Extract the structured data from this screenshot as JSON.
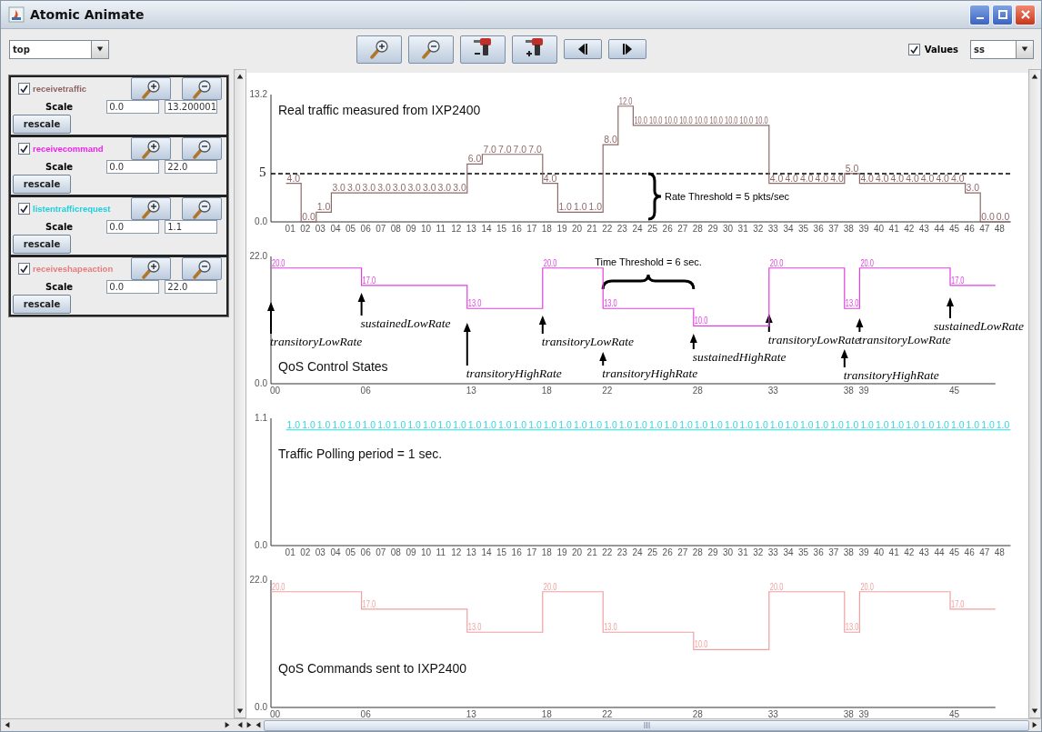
{
  "window": {
    "title": "Atomic Animate"
  },
  "toolbar": {
    "view_select": {
      "value": "top"
    },
    "tools": [
      {
        "kind": "zoom_in"
      },
      {
        "kind": "zoom_out"
      },
      {
        "kind": "drill_minus"
      },
      {
        "kind": "drill_plus"
      },
      {
        "kind": "step_back"
      },
      {
        "kind": "step_forward"
      }
    ],
    "values_toggle": {
      "label": "Values",
      "checked": true
    },
    "format_select": {
      "value": "ss"
    }
  },
  "signals": [
    {
      "name": "receivetraffic",
      "color": "#8e6464",
      "checked": true,
      "scale_label": "Scale",
      "min": "0.0",
      "max": "13.200001",
      "rescale": "rescale"
    },
    {
      "name": "receivecommand",
      "color": "#ee22ee",
      "checked": true,
      "scale_label": "Scale",
      "min": "0.0",
      "max": "22.0",
      "rescale": "rescale"
    },
    {
      "name": "listentrafficrequest",
      "color": "#1ccfdc",
      "checked": true,
      "scale_label": "Scale",
      "min": "0.0",
      "max": "1.1",
      "rescale": "rescale"
    },
    {
      "name": "receiveshapeaction",
      "color": "#e87c7c",
      "checked": true,
      "scale_label": "Scale",
      "min": "0.0",
      "max": "22.0",
      "rescale": "rescale"
    }
  ],
  "charts": [
    {
      "chart_data": {
        "type": "line",
        "title": "Real traffic measured from IXP2400",
        "x": [
          1,
          2,
          2,
          3,
          3,
          4,
          4,
          5,
          6,
          7,
          8,
          9,
          10,
          11,
          12,
          13,
          13,
          14,
          14,
          15,
          16,
          17,
          18,
          18,
          19,
          19,
          20,
          21,
          22,
          22,
          23,
          23,
          24,
          24,
          25,
          26,
          27,
          28,
          29,
          30,
          31,
          32,
          33,
          33,
          34,
          35,
          36,
          37,
          38,
          38,
          39,
          39,
          40,
          41,
          42,
          43,
          44,
          45,
          46,
          46,
          47,
          47,
          48,
          49
        ],
        "series": [
          {
            "color": "#8e6a6a",
            "values": [
              4,
              4,
              0,
              0,
              1,
              1,
              3,
              3,
              3,
              3,
              3,
              3,
              3,
              3,
              3,
              3,
              6,
              6,
              7,
              7,
              7,
              7,
              7,
              4,
              4,
              1,
              1,
              1,
              1,
              8,
              8,
              12,
              12,
              10,
              10,
              10,
              10,
              10,
              10,
              10,
              10,
              10,
              10,
              4,
              4,
              4,
              4,
              4,
              4,
              5,
              5,
              4,
              4,
              4,
              4,
              4,
              4,
              4,
              4,
              3,
              3,
              0,
              0,
              0
            ],
            "value_labels": [
              "4.0",
              null,
              "0.0",
              null,
              "1.0",
              null,
              "3.0",
              "3.0",
              "3.0",
              "3.0",
              "3.0",
              "3.0",
              "3.0",
              "3.0",
              "3.0",
              null,
              "6.0",
              null,
              "7.0",
              "7.0",
              "7.0",
              "7.0",
              null,
              "4.0",
              null,
              "1.0",
              "1.0",
              "1.0",
              null,
              "8.0",
              null,
              "12.0",
              null,
              "10.0",
              "10.0",
              "10.0",
              "10.0",
              "10.0",
              "10.0",
              "10.0",
              "10.0",
              "10.0",
              null,
              "4.0",
              "4.0",
              "4.0",
              "4.0",
              "4.0",
              null,
              "5.0",
              null,
              "4.0",
              "4.0",
              "4.0",
              "4.0",
              "4.0",
              "4.0",
              "4.0",
              null,
              "3.0",
              null,
              "0.0",
              "0.0",
              null
            ]
          }
        ],
        "xlim": [
          0,
          49
        ],
        "ylim": [
          0,
          13.2
        ],
        "xticks": [
          {
            "value": 1,
            "label": "01"
          },
          {
            "value": 2,
            "label": "02"
          },
          {
            "value": 3,
            "label": "03"
          },
          {
            "value": 4,
            "label": "04"
          },
          {
            "value": 5,
            "label": "05"
          },
          {
            "value": 6,
            "label": "06"
          },
          {
            "value": 7,
            "label": "07"
          },
          {
            "value": 8,
            "label": "08"
          },
          {
            "value": 9,
            "label": "09"
          },
          10,
          11,
          12,
          13,
          14,
          15,
          16,
          17,
          18,
          19,
          20,
          21,
          22,
          23,
          24,
          25,
          26,
          27,
          28,
          29,
          30,
          31,
          32,
          33,
          34,
          35,
          36,
          37,
          38,
          39,
          40,
          41,
          42,
          43,
          44,
          45,
          46,
          47,
          48
        ],
        "yticks": [
          {
            "value": 0,
            "label": "0.0"
          },
          {
            "value": 13.2,
            "label": "13.2"
          }
        ],
        "ref_lines": [
          {
            "axis": "y",
            "value": 5,
            "label": "5"
          }
        ],
        "annotations": [
          "Rate Threshold = 5 pkts/sec"
        ]
      }
    },
    {
      "chart_data": {
        "type": "line",
        "title": "QoS Control States",
        "x": [
          0,
          6,
          6,
          13,
          13,
          18,
          18,
          22,
          22,
          28,
          28,
          33,
          33,
          38,
          38,
          39,
          39,
          45,
          45,
          48
        ],
        "series": [
          {
            "color": "#e040e0",
            "values": [
              20,
              20,
              17,
              17,
              13,
              13,
              20,
              20,
              13,
              13,
              10,
              10,
              20,
              20,
              13,
              13,
              20,
              20,
              17,
              17
            ],
            "value_labels": [
              "20.0",
              null,
              "17.0",
              null,
              "13.0",
              null,
              "20.0",
              null,
              "13.0",
              null,
              "10.0",
              null,
              "20.0",
              null,
              "13.0",
              null,
              "20.0",
              null,
              "17.0",
              null
            ]
          }
        ],
        "xlim": [
          0,
          48
        ],
        "ylim": [
          0,
          22
        ],
        "xticks": [
          {
            "value": 0,
            "label": "00"
          },
          {
            "value": 6,
            "label": "06"
          },
          13,
          18,
          22,
          28,
          33,
          38,
          39,
          45
        ],
        "yticks": [
          {
            "value": 0,
            "label": "0.0"
          },
          {
            "value": 22,
            "label": "22.0"
          }
        ],
        "annotations": [
          "Time Threshold = 6 sec.",
          "transitoryLowRate",
          "sustainedLowRate",
          "transitoryHighRate",
          "transitoryLowRate",
          "transitoryHighRate",
          "sustainedHighRate",
          "transitoryLowRate",
          "transitoryHighRate",
          "transitoryLowRate",
          "sustainedLowRate"
        ]
      }
    },
    {
      "chart_data": {
        "type": "line",
        "title": "Traffic Polling period = 1 sec.",
        "x": [
          1,
          2,
          3,
          4,
          5,
          6,
          7,
          8,
          9,
          10,
          11,
          12,
          13,
          14,
          15,
          16,
          17,
          18,
          19,
          20,
          21,
          22,
          23,
          24,
          25,
          26,
          27,
          28,
          29,
          30,
          31,
          32,
          33,
          34,
          35,
          36,
          37,
          38,
          39,
          40,
          41,
          42,
          43,
          44,
          45,
          46,
          47,
          48,
          49
        ],
        "series": [
          {
            "color": "#30d8e0",
            "values": [
              1,
              1,
              1,
              1,
              1,
              1,
              1,
              1,
              1,
              1,
              1,
              1,
              1,
              1,
              1,
              1,
              1,
              1,
              1,
              1,
              1,
              1,
              1,
              1,
              1,
              1,
              1,
              1,
              1,
              1,
              1,
              1,
              1,
              1,
              1,
              1,
              1,
              1,
              1,
              1,
              1,
              1,
              1,
              1,
              1,
              1,
              1,
              1,
              1
            ],
            "value_labels": [
              "1.0",
              "1.0",
              "1.0",
              "1.0",
              "1.0",
              "1.0",
              "1.0",
              "1.0",
              "1.0",
              "1.0",
              "1.0",
              "1.0",
              "1.0",
              "1.0",
              "1.0",
              "1.0",
              "1.0",
              "1.0",
              "1.0",
              "1.0",
              "1.0",
              "1.0",
              "1.0",
              "1.0",
              "1.0",
              "1.0",
              "1.0",
              "1.0",
              "1.0",
              "1.0",
              "1.0",
              "1.0",
              "1.0",
              "1.0",
              "1.0",
              "1.0",
              "1.0",
              "1.0",
              "1.0",
              "1.0",
              "1.0",
              "1.0",
              "1.0",
              "1.0",
              "1.0",
              "1.0",
              "1.0",
              "1.0",
              null
            ]
          }
        ],
        "xlim": [
          0,
          49
        ],
        "ylim": [
          0,
          1.1
        ],
        "xticks": [
          {
            "value": 1,
            "label": "01"
          },
          {
            "value": 2,
            "label": "02"
          },
          {
            "value": 3,
            "label": "03"
          },
          {
            "value": 4,
            "label": "04"
          },
          {
            "value": 5,
            "label": "05"
          },
          {
            "value": 6,
            "label": "06"
          },
          {
            "value": 7,
            "label": "07"
          },
          {
            "value": 8,
            "label": "08"
          },
          {
            "value": 9,
            "label": "09"
          },
          10,
          11,
          12,
          13,
          14,
          15,
          16,
          17,
          18,
          19,
          20,
          21,
          22,
          23,
          24,
          25,
          26,
          27,
          28,
          29,
          30,
          31,
          32,
          33,
          34,
          35,
          36,
          37,
          38,
          39,
          40,
          41,
          42,
          43,
          44,
          45,
          46,
          47,
          48
        ],
        "yticks": [
          {
            "value": 0,
            "label": "0.0"
          },
          {
            "value": 1.1,
            "label": "1.1"
          }
        ]
      }
    },
    {
      "chart_data": {
        "type": "line",
        "title": "QoS Commands sent to IXP2400",
        "x": [
          0,
          6,
          6,
          13,
          13,
          18,
          18,
          22,
          22,
          28,
          28,
          33,
          33,
          38,
          38,
          39,
          39,
          45,
          45,
          48
        ],
        "series": [
          {
            "color": "#f0a0a0",
            "values": [
              20,
              20,
              17,
              17,
              13,
              13,
              20,
              20,
              13,
              13,
              10,
              10,
              20,
              20,
              13,
              13,
              20,
              20,
              17,
              17
            ],
            "value_labels": [
              "20.0",
              null,
              "17.0",
              null,
              "13.0",
              null,
              "20.0",
              null,
              "13.0",
              null,
              "10.0",
              null,
              "20.0",
              null,
              "13.0",
              null,
              "20.0",
              null,
              "17.0",
              null
            ]
          }
        ],
        "xlim": [
          0,
          48
        ],
        "ylim": [
          0,
          22
        ],
        "xticks": [
          {
            "value": 0,
            "label": "00"
          },
          {
            "value": 6,
            "label": "06"
          },
          13,
          18,
          22,
          28,
          33,
          38,
          39,
          45
        ],
        "yticks": [
          {
            "value": 0,
            "label": "0.0"
          },
          {
            "value": 22,
            "label": "22.0"
          }
        ]
      }
    }
  ]
}
